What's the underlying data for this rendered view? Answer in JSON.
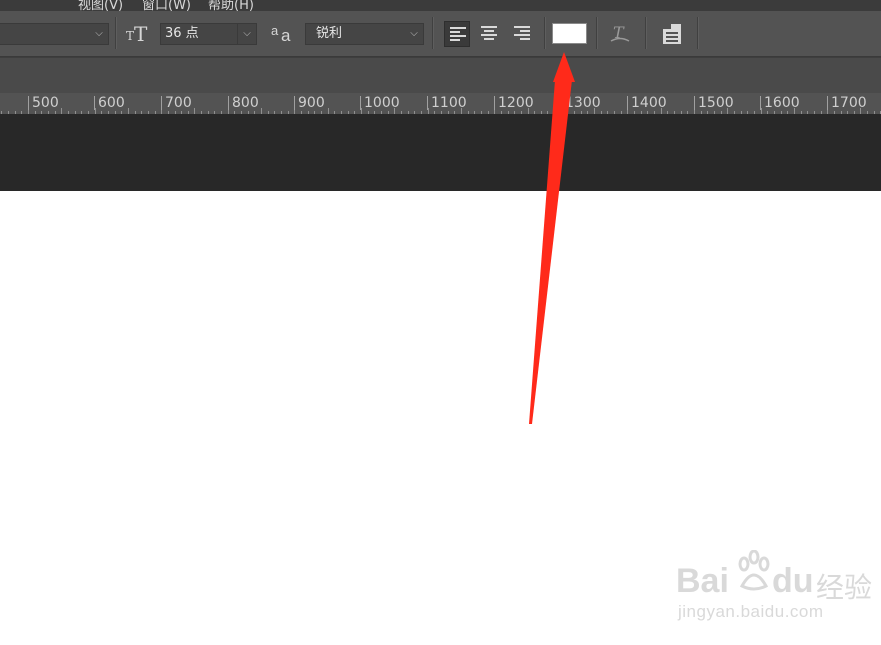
{
  "menubar": {
    "items": [
      "视图(V)",
      "窗口(W)",
      "帮助(H)"
    ]
  },
  "options_bar": {
    "font_size": {
      "value": "36 点",
      "icon": "text-size-icon"
    },
    "antialias": {
      "icon": "antialias-aa-icon",
      "label_small": "a",
      "label_large": "a",
      "value": "锐利"
    },
    "align": [
      {
        "name": "align-left",
        "icon": "align-left-icon",
        "active": true
      },
      {
        "name": "align-center",
        "icon": "align-center-icon",
        "active": false
      },
      {
        "name": "align-right",
        "icon": "align-right-icon",
        "active": false
      }
    ],
    "text_color": "#ffffff",
    "warp_icon": "warp-text-icon",
    "panels_icon": "character-panel-icon"
  },
  "ruler": {
    "labels": [
      "500",
      "600",
      "700",
      "800",
      "900",
      "1000",
      "1100",
      "1200",
      "1300",
      "1400",
      "1500",
      "1600",
      "1700"
    ]
  },
  "annotation": {
    "arrow_color": "#ff2a1a"
  },
  "watermark": {
    "logo_latin": "Bai",
    "logo_latin_2": "du",
    "logo_cn": "经验",
    "url": "jingyan.baidu.com"
  },
  "colors": {
    "ui_panel": "#535353",
    "ui_dark": "#282828",
    "canvas": "#ffffff"
  }
}
